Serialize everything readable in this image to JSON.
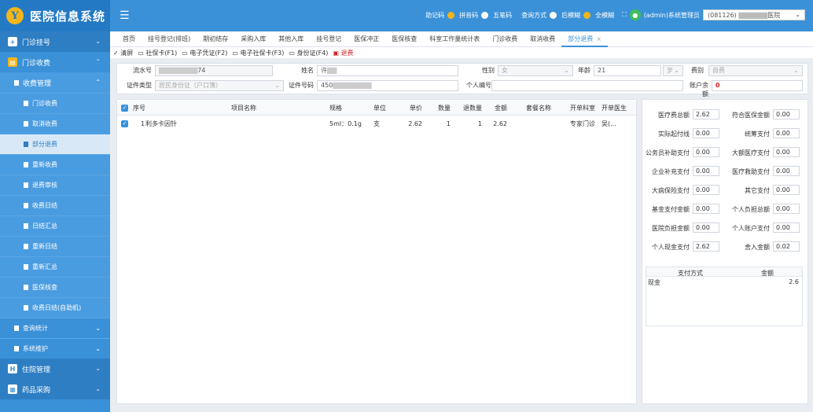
{
  "app": {
    "title": "医院信息系统",
    "logo_letter": "Y"
  },
  "sidebar": {
    "groups": [
      {
        "label": "门诊挂号",
        "icon": "plus-icon"
      },
      {
        "label": "门诊收费",
        "icon": "receipt-icon"
      }
    ],
    "subgroup": "收费管理",
    "items": [
      "门诊收费",
      "取消收费",
      "部分退费",
      "重新收费",
      "退费审核",
      "收费日结",
      "日结汇总",
      "重新日结",
      "重新汇总",
      "医保核查",
      "收费日结(自助机)"
    ],
    "active_index": 2,
    "subgroups2": [
      "查询统计",
      "系统维护"
    ],
    "groups2": [
      {
        "label": "住院管理",
        "icon": "hospital-icon"
      },
      {
        "label": "药品采购",
        "icon": "cart-icon"
      }
    ]
  },
  "topbar": {
    "search_modes": [
      "助记码",
      "拼音码",
      "五笔码"
    ],
    "query_label": "查询方式",
    "query_modes": [
      "后模糊",
      "全模糊"
    ],
    "user": "(admin)系统管理员",
    "hospital": "(081126)",
    "hospital_suffix": "医院"
  },
  "tabs": [
    "首页",
    "挂号登记(排班)",
    "期初结存",
    "采购入库",
    "其他入库",
    "挂号登记",
    "医保冲正",
    "医保核查",
    "科室工作量统计表",
    "门诊收费",
    "取消收费",
    "部分退费"
  ],
  "toolbar": [
    "✓ 清屏",
    "▭ 社保卡(F1)",
    "▭ 电子凭证(F2)",
    "▭ 电子社保卡(F3)",
    "▭ 身份证(F4)",
    "▣ 退费"
  ],
  "form": {
    "serial_label": "流水号",
    "serial_value": "74",
    "name_label": "姓名",
    "name_value": "许",
    "gender_label": "性别",
    "gender_value": "女",
    "age_label": "年龄",
    "age_value": "21",
    "age_unit": "岁",
    "fee_type_label": "费别",
    "fee_type_value": "自费",
    "id_type_label": "证件类型",
    "id_type_value": "居民身份证（户口簿）",
    "id_no_label": "证件号码",
    "id_no_value": "450",
    "personal_no_label": "个人编号",
    "personal_no_value": "",
    "balance_label": "账户余额",
    "balance_value": "0"
  },
  "grid": {
    "headers": [
      "序号",
      "项目名称",
      "规格",
      "单位",
      "单价",
      "数量",
      "退数量",
      "金额",
      "套餐名称",
      "开单科室",
      "开单医生"
    ],
    "rows": [
      [
        "1",
        "利多卡因针",
        "5ml：0.1g",
        "支",
        "2.62",
        "1",
        "1",
        "2.62",
        "",
        "专家门诊",
        "吴(..."
      ]
    ]
  },
  "summary": {
    "fields": [
      [
        "医疗费总额",
        "2.62",
        "符合医保金额",
        "0.00"
      ],
      [
        "实际起付线",
        "0.00",
        "统筹支付",
        "0.00"
      ],
      [
        "公务员补助支付",
        "0.00",
        "大额医疗支付",
        "0.00"
      ],
      [
        "企业补充支付",
        "0.00",
        "医疗救助支付",
        "0.00"
      ],
      [
        "大病保险支付",
        "0.00",
        "其它支付",
        "0.00"
      ],
      [
        "基金支付金额",
        "0.00",
        "个人负担总额",
        "0.00"
      ],
      [
        "医院负担金额",
        "0.00",
        "个人账户支付",
        "0.00"
      ],
      [
        "个人现金支付",
        "2.62",
        "舍入金额",
        "0.02"
      ]
    ],
    "pay_headers": [
      "支付方式",
      "金额"
    ],
    "pay_rows": [
      [
        "现金",
        "2.6"
      ]
    ]
  }
}
